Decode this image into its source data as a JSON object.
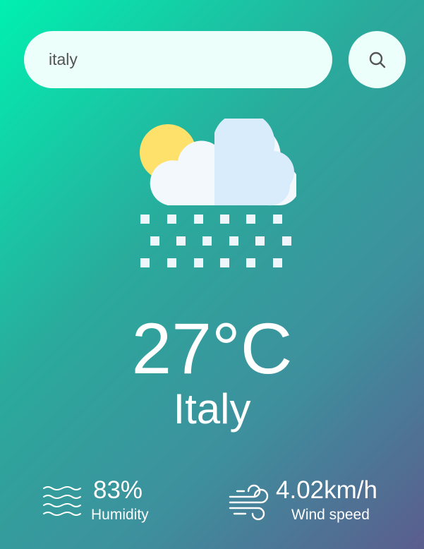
{
  "search": {
    "value": "italy",
    "placeholder": "",
    "button_icon": "search-icon"
  },
  "weather": {
    "icon": "partly-cloudy-snow-icon",
    "temperature": "27°C",
    "city": "Italy"
  },
  "humidity": {
    "icon": "humidity-waves-icon",
    "value": "83%",
    "label": "Humidity"
  },
  "wind": {
    "icon": "wind-icon",
    "value": "4.02km/h",
    "label": "Wind speed"
  },
  "colors": {
    "gradient_start": "#00f0b0",
    "gradient_end": "#5b5d8e",
    "input_bg": "#ecfffb",
    "text": "#ffffff"
  }
}
